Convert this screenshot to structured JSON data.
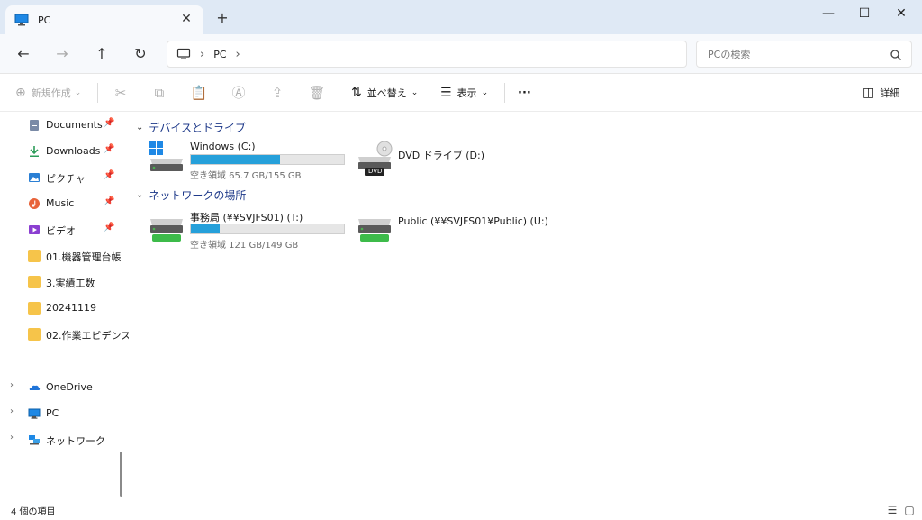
{
  "window": {
    "tab_title": "PC",
    "new_tab": "+",
    "minimize": "—",
    "maximize": "☐",
    "close": "✕"
  },
  "nav": {
    "address_segments": [
      "PC"
    ],
    "search_placeholder": "PCの検索"
  },
  "commands": {
    "new": "新規作成",
    "sort": "並べ替え",
    "view": "表示",
    "more": "···",
    "details": "詳細"
  },
  "sidebar": {
    "pinned": [
      {
        "label": "Documents",
        "icon": "document-icon"
      },
      {
        "label": "Downloads",
        "icon": "download-icon"
      },
      {
        "label": "ピクチャ",
        "icon": "pictures-icon"
      },
      {
        "label": "Music",
        "icon": "music-icon"
      },
      {
        "label": "ビデオ",
        "icon": "video-icon"
      }
    ],
    "folders": [
      "01.機器管理台帳",
      "3.実績工数",
      "20241119",
      "02.作業エビデンス"
    ],
    "roots": [
      {
        "label": "OneDrive",
        "icon": "onedrive-icon"
      },
      {
        "label": "PC",
        "icon": "pc-icon",
        "selected": true
      },
      {
        "label": "ネットワーク",
        "icon": "network-icon"
      }
    ]
  },
  "groups": {
    "devices": "デバイスとドライブ",
    "network": "ネットワークの場所"
  },
  "drives": {
    "c": {
      "name": "Windows (C:)",
      "free": "空き領域 65.7 GB/155 GB",
      "used_fraction": 0.58
    },
    "dvd": {
      "name": "DVD ドライブ (D:)",
      "badge": "DVD"
    },
    "t": {
      "name": "事務局 (¥¥SVJFS01) (T:)",
      "free": "空き領域 121 GB/149 GB",
      "used_fraction": 0.19
    },
    "u": {
      "name": "Public (¥¥SVJFS01¥Public) (U:)"
    }
  },
  "status": {
    "item_count": "4 個の項目"
  },
  "colors": {
    "accent": "#26a0da",
    "selection_outline": "#e0101d",
    "selection_fill": "#cde6f7",
    "titlebar": "#dfe9f5"
  }
}
